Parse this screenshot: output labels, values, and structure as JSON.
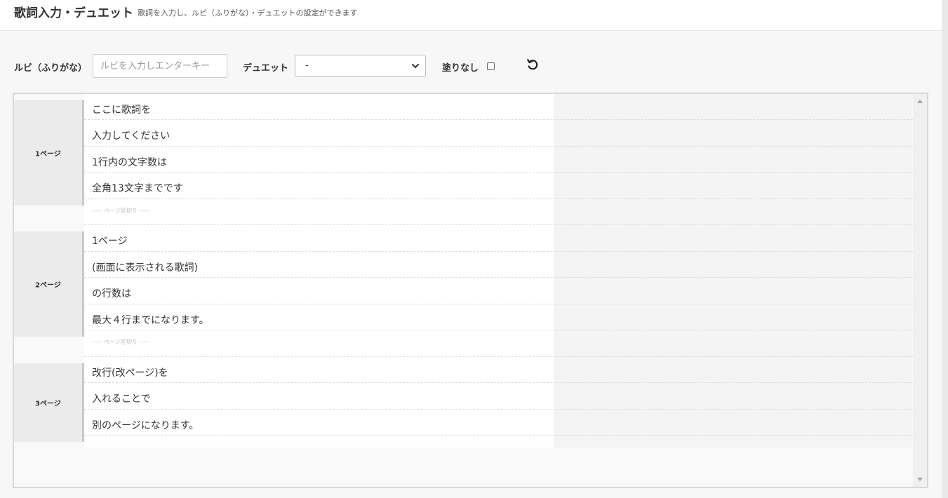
{
  "header": {
    "title": "歌詞入力・デュエット",
    "subtitle": "歌詞を入力し、ルビ（ふりがな）・デュエットの設定ができます"
  },
  "toolbar": {
    "ruby_label": "ルビ（ふりがな）",
    "ruby_placeholder": "ルビを入力しエンターキー",
    "ruby_value": "",
    "duet_label": "デュエット",
    "duet_selected": "-",
    "no_fill_label": "塗りなし",
    "no_fill_checked": false,
    "undo_icon": "undo-icon"
  },
  "editor": {
    "pages": [
      {
        "label": "1ページ",
        "lines": [
          "ここに歌詞を",
          "入力してください",
          "1行内の文字数は",
          "全角13文字までです"
        ]
      },
      {
        "label": "2ページ",
        "lines": [
          "1ページ",
          "(画面に表示される歌詞)",
          "の行数は",
          "最大４行までになります。"
        ]
      },
      {
        "label": "3ページ",
        "lines": [
          "改行(改ページ)を",
          "入れることで",
          "別のページになります。"
        ]
      }
    ],
    "page_break_label": "----- ページ区切り -----"
  },
  "colors": {
    "page_label_bg": "#ebebeb",
    "page_border": "#c8c8c8",
    "separator_text": "#bdbdbd"
  }
}
